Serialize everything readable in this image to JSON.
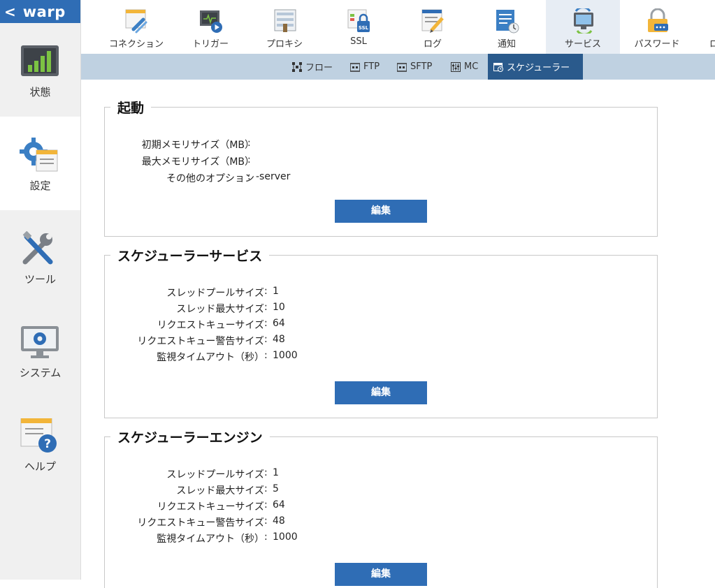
{
  "app": {
    "logo": "warp",
    "back_glyph": "<"
  },
  "sidebar": {
    "items": [
      {
        "label": "状態",
        "icon": "bar-chart-icon"
      },
      {
        "label": "設定",
        "icon": "gear-settings-icon"
      },
      {
        "label": "ツール",
        "icon": "tools-icon"
      },
      {
        "label": "システム",
        "icon": "monitor-gear-icon"
      },
      {
        "label": "ヘルプ",
        "icon": "help-icon"
      }
    ],
    "active_index": 1
  },
  "topnav": {
    "tabs": [
      {
        "label": "コネクション",
        "icon": "connection-link-icon"
      },
      {
        "label": "トリガー",
        "icon": "trigger-play-icon"
      },
      {
        "label": "プロキシ",
        "icon": "proxy-server-icon"
      },
      {
        "label": "SSL",
        "icon": "ssl-lock-icon"
      },
      {
        "label": "ログ",
        "icon": "log-pencil-icon"
      },
      {
        "label": "通知",
        "icon": "notification-icon"
      },
      {
        "label": "サービス",
        "icon": "service-icon"
      },
      {
        "label": "パスワード",
        "icon": "password-lock-icon"
      },
      {
        "label": "ロ",
        "icon": ""
      }
    ],
    "active_index": 6
  },
  "subnav": {
    "tabs": [
      {
        "label": "フロー",
        "icon": "flow-icon"
      },
      {
        "label": "FTP",
        "icon": "ftp-icon"
      },
      {
        "label": "SFTP",
        "icon": "sftp-icon"
      },
      {
        "label": "MC",
        "icon": "mc-sliders-icon"
      },
      {
        "label": "スケジューラー",
        "icon": "scheduler-icon"
      }
    ],
    "active_index": 4
  },
  "sections": {
    "startup": {
      "title": "起動",
      "rows": [
        {
          "key": "初期メモリサイズ（MB）",
          "value": ""
        },
        {
          "key": "最大メモリサイズ（MB）",
          "value": ""
        },
        {
          "key": "その他のオプション",
          "value": "-server"
        }
      ],
      "button": "編集"
    },
    "scheduler_service": {
      "title": "スケジューラーサービス",
      "rows": [
        {
          "key": "スレッドプールサイズ",
          "value": "1"
        },
        {
          "key": "スレッド最大サイズ",
          "value": "10"
        },
        {
          "key": "リクエストキューサイズ",
          "value": "64"
        },
        {
          "key": "リクエストキュー警告サイズ",
          "value": "48"
        },
        {
          "key": "監視タイムアウト（秒）",
          "value": "1000"
        }
      ],
      "button": "編集"
    },
    "scheduler_engine": {
      "title": "スケジューラーエンジン",
      "rows": [
        {
          "key": "スレッドプールサイズ",
          "value": "1"
        },
        {
          "key": "スレッド最大サイズ",
          "value": "5"
        },
        {
          "key": "リクエストキューサイズ",
          "value": "64"
        },
        {
          "key": "リクエストキュー警告サイズ",
          "value": "48"
        },
        {
          "key": "監視タイムアウト（秒）",
          "value": "1000"
        }
      ],
      "button": "編集"
    }
  },
  "separator": " : ",
  "colors": {
    "brand_blue": "#2f6db5",
    "subnav_bg": "#bfd1e1",
    "subnav_active": "#2a5a8c",
    "tab_active_bg": "#e7edf4"
  }
}
